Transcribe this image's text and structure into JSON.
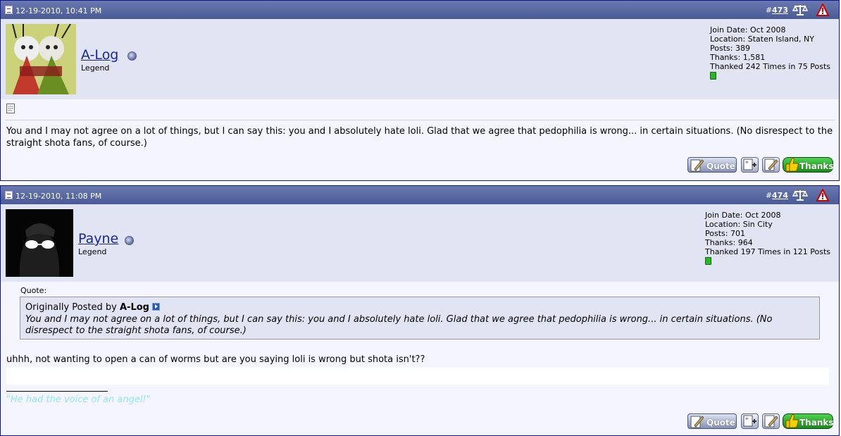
{
  "posts": [
    {
      "date": "12-19-2010, 10:41 PM",
      "post_prefix": "#",
      "post_number": "473",
      "username": "A-Log",
      "user_title": "Legend",
      "info": {
        "join_date": "Join Date: Oct 2008",
        "location": "Location: Staten Island, NY",
        "posts": "Posts: 389",
        "thanks": "Thanks: 1,581",
        "thanked": "Thanked 242 Times in 75 Posts"
      },
      "message": "You and I may not agree on a lot of things, but I can say this: you and I absolutely hate loli. Glad that we agree that pedophilia is wrong... in certain situations. (No disrespect to the straight shota fans, of course.)"
    },
    {
      "date": "12-19-2010, 11:08 PM",
      "post_prefix": "#",
      "post_number": "474",
      "username": "Payne",
      "user_title": "Legend",
      "info": {
        "join_date": "Join Date: Oct 2008",
        "location": "Location: Sin City",
        "posts": "Posts: 701",
        "thanks": "Thanks: 964",
        "thanked": "Thanked 197 Times in 121 Posts"
      },
      "quote_label": "Quote:",
      "quote_prefix": "Originally Posted by",
      "quote_author": "A-Log",
      "quote_text": "You and I may not agree on a lot of things, but I can say this: you and I absolutely hate loli. Glad that we agree that pedophilia is wrong... in certain situations. (No disrespect to the straight shota fans, of course.)",
      "message": "uhhh, not wanting to open a can of worms but are you saying loli is wrong but shota isn't??",
      "signature": "\"He had the voice of an angel!\""
    }
  ],
  "buttons": {
    "quote": "Quote",
    "thanks": "Thanks"
  },
  "colors": {
    "header_bar": "#5565a1",
    "userbar": "#e1e4f2",
    "post_bg": "#f5f5ff",
    "username_link": "#1a2791",
    "signature": "#8fe7f0",
    "thanks_button": "#2bab2b"
  },
  "icons": [
    "post-doc-icon",
    "report-scale-icon",
    "warning-icon",
    "online-status-icon",
    "reputation-icon",
    "message-icon",
    "view-post-arrow-icon",
    "quote-pen-icon",
    "multiquote-icon",
    "quick-reply-icon",
    "thumbs-up-icon"
  ]
}
